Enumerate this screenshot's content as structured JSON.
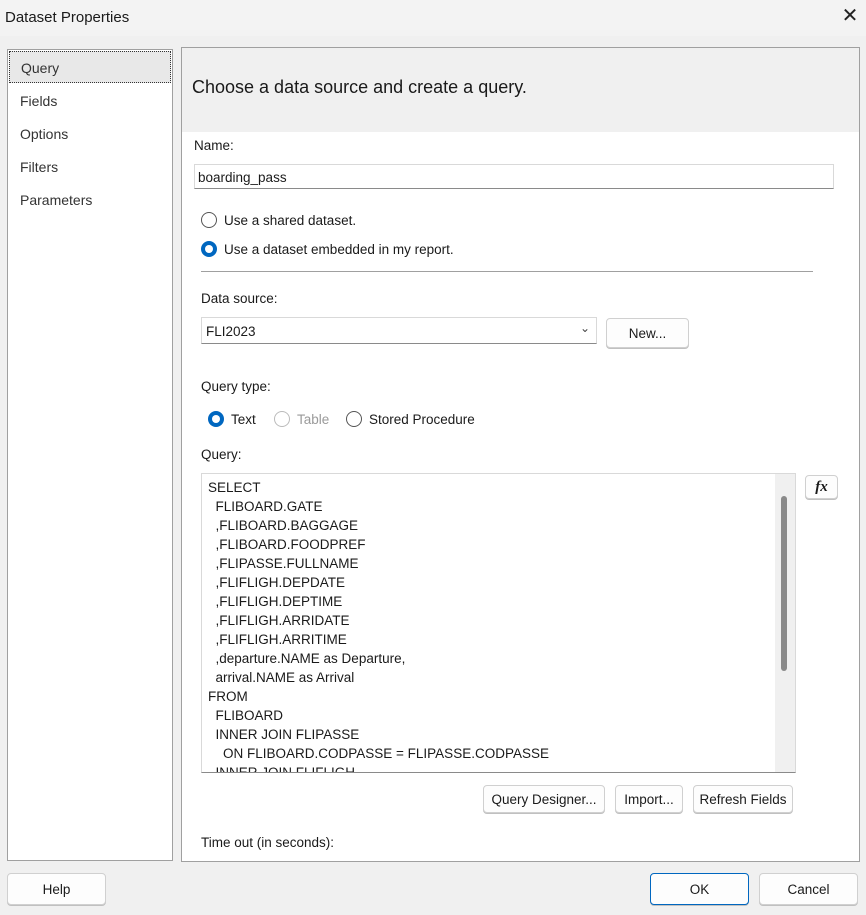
{
  "window": {
    "title": "Dataset Properties",
    "close_icon": "close-icon"
  },
  "nav": {
    "items": [
      {
        "label": "Query",
        "selected": true
      },
      {
        "label": "Fields"
      },
      {
        "label": "Options"
      },
      {
        "label": "Filters"
      },
      {
        "label": "Parameters"
      }
    ]
  },
  "main": {
    "heading": "Choose a data source and create a query.",
    "name_label": "Name:",
    "name_value": "boarding_pass",
    "radio_shared": "Use a shared dataset.",
    "radio_embedded": "Use a dataset embedded in my report.",
    "datasource_label": "Data source:",
    "datasource_value": "FLI2023",
    "new_button": "New...",
    "querytype_label": "Query type:",
    "qt_text": "Text",
    "qt_table": "Table",
    "qt_stored": "Stored Procedure",
    "query_label": "Query:",
    "query_text": "SELECT\n  FLIBOARD.GATE\n  ,FLIBOARD.BAGGAGE\n  ,FLIBOARD.FOODPREF\n  ,FLIPASSE.FULLNAME\n  ,FLIFLIGH.DEPDATE\n  ,FLIFLIGH.DEPTIME\n  ,FLIFLIGH.ARRIDATE\n  ,FLIFLIGH.ARRITIME\n  ,departure.NAME as Departure,\n  arrival.NAME as Arrival\nFROM\n  FLIBOARD\n  INNER JOIN FLIPASSE\n    ON FLIBOARD.CODPASSE = FLIPASSE.CODPASSE\n  INNER JOIN FLIFLIGH",
    "fx_label": "fx",
    "query_designer": "Query Designer...",
    "import": "Import...",
    "refresh_fields": "Refresh Fields",
    "timeout_label": "Time out (in seconds):"
  },
  "footer": {
    "help": "Help",
    "ok": "OK",
    "cancel": "Cancel"
  },
  "colors": {
    "accent": "#0067c0"
  }
}
